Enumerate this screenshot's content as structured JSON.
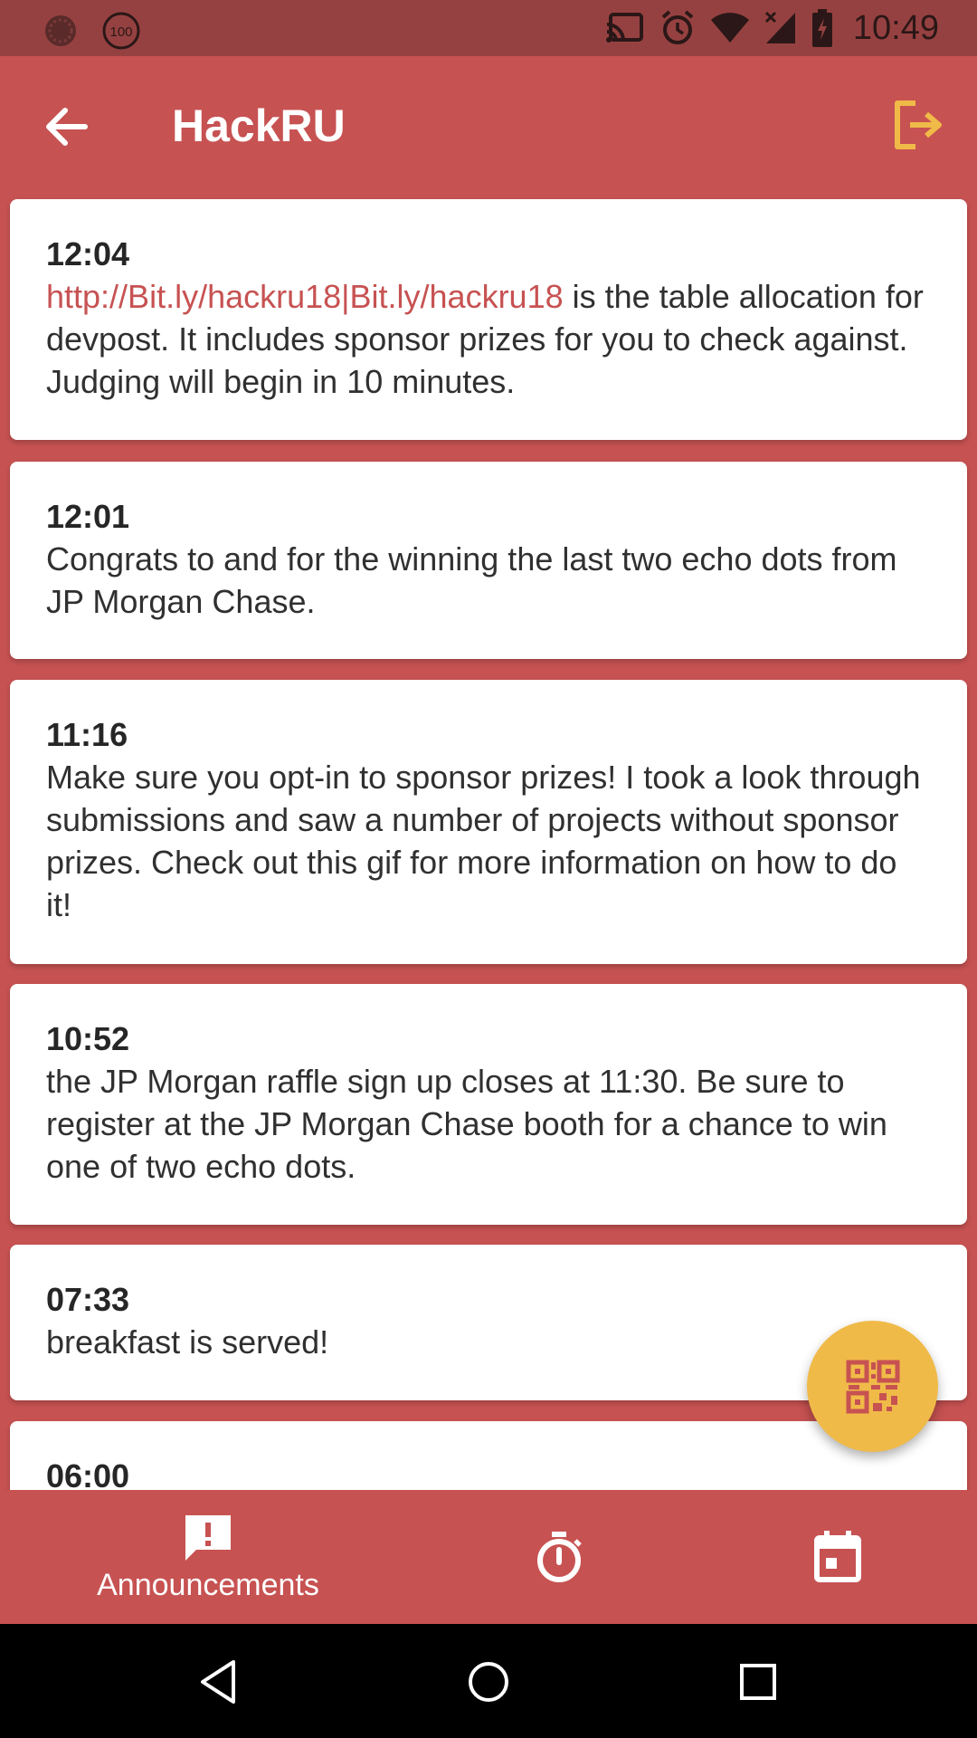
{
  "status_bar": {
    "time": "10:49",
    "left_icons": [
      "notification-dot-icon",
      "battery-100-icon"
    ],
    "battery_badge": "100",
    "right_icons": [
      "cast-icon",
      "alarm-icon",
      "wifi-icon",
      "cell-signal-icon",
      "battery-charging-icon"
    ]
  },
  "app_bar": {
    "title": "HackRU",
    "back_icon": "arrow-back-icon",
    "logout_icon": "logout-icon"
  },
  "announcements": [
    {
      "time": "12:04",
      "link": "http://Bit.ly/hackru18|Bit.ly/hackru18",
      "text": " is the table allocation for devpost. It includes sponsor prizes for you to check against. Judging will begin in 10 minutes."
    },
    {
      "time": "12:01",
      "text": "Congrats to and for the winning the last two echo dots from JP Morgan Chase."
    },
    {
      "time": "11:16",
      "text": "Make sure you opt-in to sponsor prizes! I took a look through submissions and saw a number of projects without sponsor prizes. Check out this gif for more information on how to do it!"
    },
    {
      "time": "10:52",
      "text": "the JP Morgan raffle sign up closes at 11:30. Be sure to register at the JP Morgan Chase booth for a chance to win one of two echo dots."
    },
    {
      "time": "07:33",
      "text": "breakfast is served!"
    },
    {
      "time": "06:00",
      "text": ""
    }
  ],
  "fab": {
    "icon": "qr-code-icon"
  },
  "bottom_nav": {
    "items": [
      {
        "label": "Announcements",
        "icon": "announcement-icon",
        "active": true
      },
      {
        "label": "",
        "icon": "timer-icon",
        "active": false
      },
      {
        "label": "",
        "icon": "calendar-icon",
        "active": false
      }
    ]
  },
  "colors": {
    "primary": "#c75252",
    "status_bar": "#964141",
    "accent": "#f0ba48",
    "card": "#ffffff"
  }
}
